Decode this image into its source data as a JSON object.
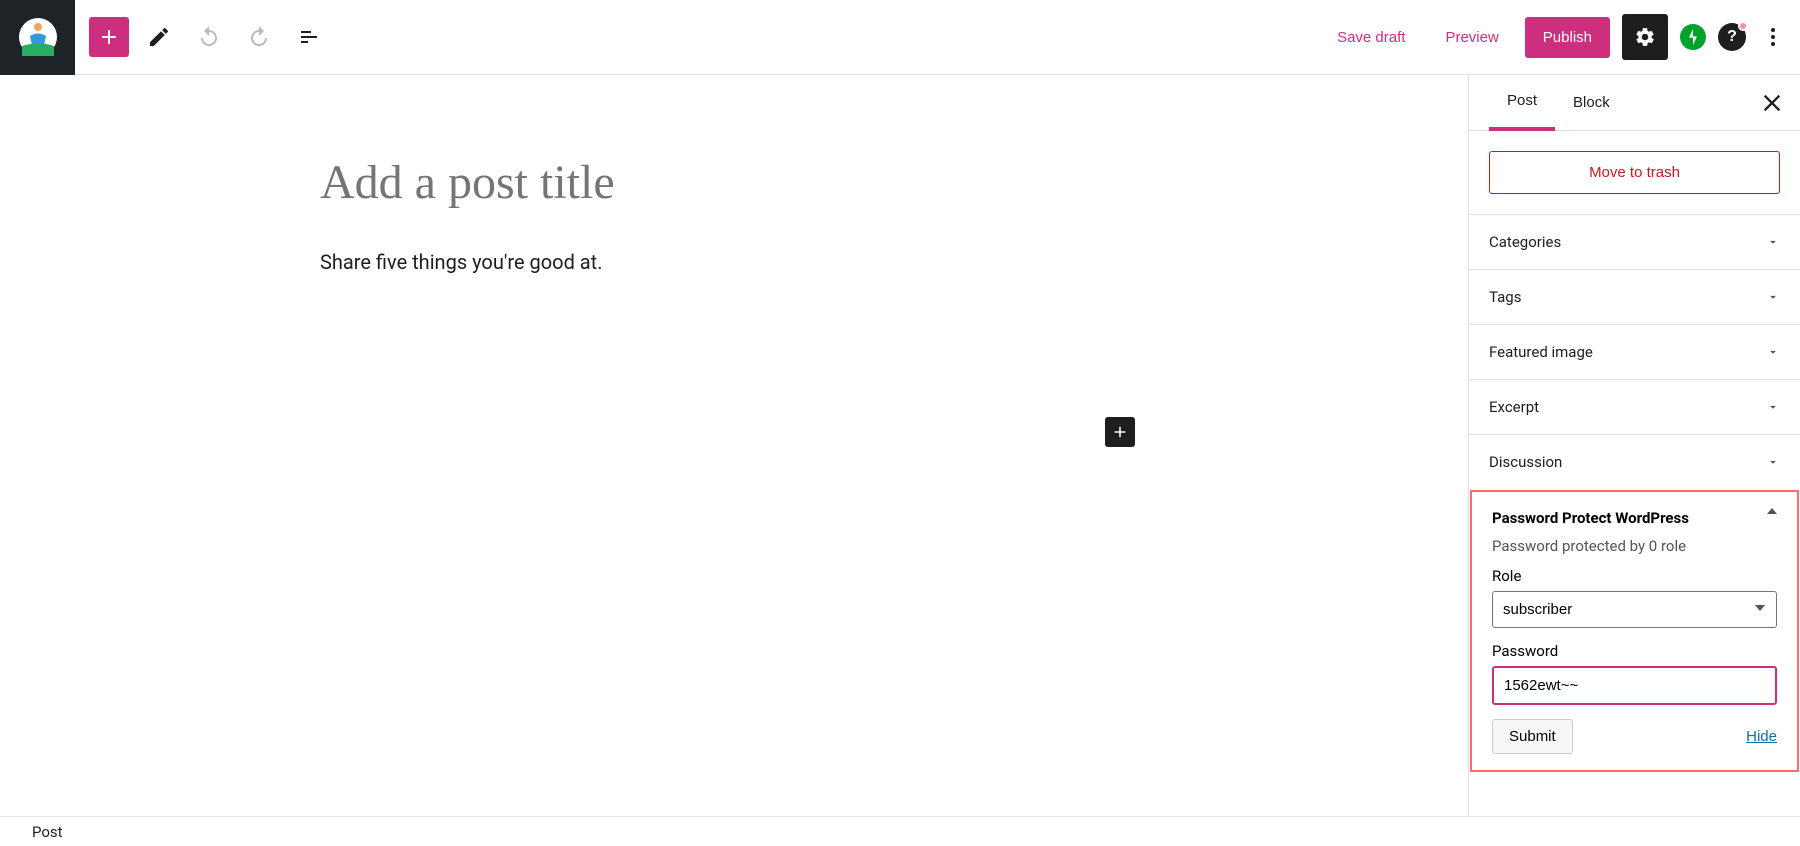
{
  "topbar": {
    "save_draft": "Save draft",
    "preview": "Preview",
    "publish": "Publish"
  },
  "editor": {
    "title_placeholder": "Add a post title",
    "prompt": "Share five things you're good at."
  },
  "sidebar": {
    "tabs": {
      "post": "Post",
      "block": "Block"
    },
    "trash": "Move to trash",
    "panels": [
      {
        "label": "Categories"
      },
      {
        "label": "Tags"
      },
      {
        "label": "Featured image"
      },
      {
        "label": "Excerpt"
      },
      {
        "label": "Discussion"
      }
    ],
    "ppw": {
      "title": "Password Protect WordPress",
      "subtitle": "Password protected by 0 role",
      "role_label": "Role",
      "role_value": "subscriber",
      "password_label": "Password",
      "password_value": "1562ewt~~",
      "submit": "Submit",
      "hide": "Hide"
    }
  },
  "bottom": {
    "breadcrumb": "Post"
  }
}
